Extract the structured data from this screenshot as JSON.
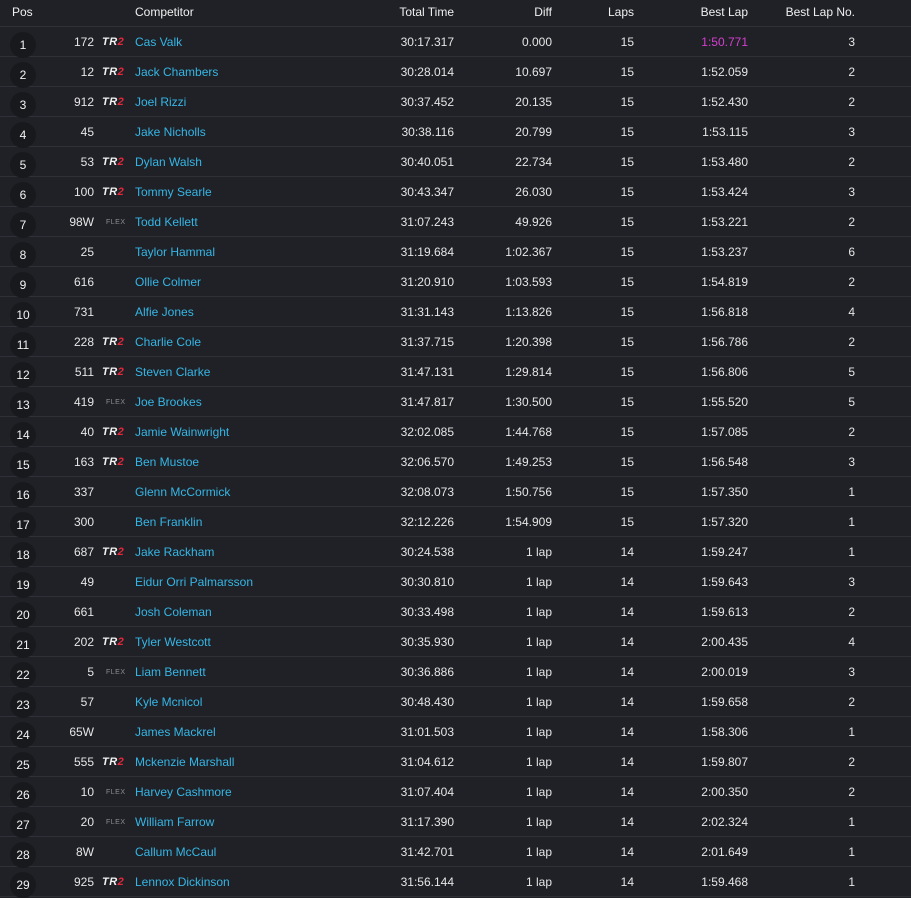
{
  "header": {
    "pos": "Pos",
    "competitor": "Competitor",
    "total_time": "Total Time",
    "diff": "Diff",
    "laps": "Laps",
    "best_lap": "Best Lap",
    "best_lap_no": "Best Lap No."
  },
  "colors": {
    "competitor_link": "#35b6e6",
    "fastest_lap": "#d63fd0",
    "tr2_red": "#e3283b",
    "background": "#1f2126"
  },
  "rows": [
    {
      "pos": "1",
      "number": "172",
      "class": "TR2",
      "competitor": "Cas Valk",
      "total_time": "30:17.317",
      "diff": "0.000",
      "laps": "15",
      "best_lap": "1:50.771",
      "best_lap_no": "3",
      "fastest": true
    },
    {
      "pos": "2",
      "number": "12",
      "class": "TR2",
      "competitor": "Jack Chambers",
      "total_time": "30:28.014",
      "diff": "10.697",
      "laps": "15",
      "best_lap": "1:52.059",
      "best_lap_no": "2"
    },
    {
      "pos": "3",
      "number": "912",
      "class": "TR2",
      "competitor": "Joel Rizzi",
      "total_time": "30:37.452",
      "diff": "20.135",
      "laps": "15",
      "best_lap": "1:52.430",
      "best_lap_no": "2"
    },
    {
      "pos": "4",
      "number": "45",
      "class": "",
      "competitor": "Jake Nicholls",
      "total_time": "30:38.116",
      "diff": "20.799",
      "laps": "15",
      "best_lap": "1:53.115",
      "best_lap_no": "3"
    },
    {
      "pos": "5",
      "number": "53",
      "class": "TR2",
      "competitor": "Dylan Walsh",
      "total_time": "30:40.051",
      "diff": "22.734",
      "laps": "15",
      "best_lap": "1:53.480",
      "best_lap_no": "2"
    },
    {
      "pos": "6",
      "number": "100",
      "class": "TR2",
      "competitor": "Tommy Searle",
      "total_time": "30:43.347",
      "diff": "26.030",
      "laps": "15",
      "best_lap": "1:53.424",
      "best_lap_no": "3"
    },
    {
      "pos": "7",
      "number": "98W",
      "class": "FLEX",
      "competitor": "Todd Kellett",
      "total_time": "31:07.243",
      "diff": "49.926",
      "laps": "15",
      "best_lap": "1:53.221",
      "best_lap_no": "2"
    },
    {
      "pos": "8",
      "number": "25",
      "class": "",
      "competitor": "Taylor Hammal",
      "total_time": "31:19.684",
      "diff": "1:02.367",
      "laps": "15",
      "best_lap": "1:53.237",
      "best_lap_no": "6"
    },
    {
      "pos": "9",
      "number": "616",
      "class": "",
      "competitor": "Ollie Colmer",
      "total_time": "31:20.910",
      "diff": "1:03.593",
      "laps": "15",
      "best_lap": "1:54.819",
      "best_lap_no": "2"
    },
    {
      "pos": "10",
      "number": "731",
      "class": "",
      "competitor": "Alfie Jones",
      "total_time": "31:31.143",
      "diff": "1:13.826",
      "laps": "15",
      "best_lap": "1:56.818",
      "best_lap_no": "4"
    },
    {
      "pos": "11",
      "number": "228",
      "class": "TR2",
      "competitor": "Charlie Cole",
      "total_time": "31:37.715",
      "diff": "1:20.398",
      "laps": "15",
      "best_lap": "1:56.786",
      "best_lap_no": "2"
    },
    {
      "pos": "12",
      "number": "511",
      "class": "TR2",
      "competitor": "Steven Clarke",
      "total_time": "31:47.131",
      "diff": "1:29.814",
      "laps": "15",
      "best_lap": "1:56.806",
      "best_lap_no": "5"
    },
    {
      "pos": "13",
      "number": "419",
      "class": "FLEX",
      "competitor": "Joe Brookes",
      "total_time": "31:47.817",
      "diff": "1:30.500",
      "laps": "15",
      "best_lap": "1:55.520",
      "best_lap_no": "5"
    },
    {
      "pos": "14",
      "number": "40",
      "class": "TR2",
      "competitor": "Jamie Wainwright",
      "total_time": "32:02.085",
      "diff": "1:44.768",
      "laps": "15",
      "best_lap": "1:57.085",
      "best_lap_no": "2"
    },
    {
      "pos": "15",
      "number": "163",
      "class": "TR2",
      "competitor": "Ben Mustoe",
      "total_time": "32:06.570",
      "diff": "1:49.253",
      "laps": "15",
      "best_lap": "1:56.548",
      "best_lap_no": "3"
    },
    {
      "pos": "16",
      "number": "337",
      "class": "",
      "competitor": "Glenn McCormick",
      "total_time": "32:08.073",
      "diff": "1:50.756",
      "laps": "15",
      "best_lap": "1:57.350",
      "best_lap_no": "1"
    },
    {
      "pos": "17",
      "number": "300",
      "class": "",
      "competitor": "Ben Franklin",
      "total_time": "32:12.226",
      "diff": "1:54.909",
      "laps": "15",
      "best_lap": "1:57.320",
      "best_lap_no": "1"
    },
    {
      "pos": "18",
      "number": "687",
      "class": "TR2",
      "competitor": "Jake Rackham",
      "total_time": "30:24.538",
      "diff": "1 lap",
      "laps": "14",
      "best_lap": "1:59.247",
      "best_lap_no": "1"
    },
    {
      "pos": "19",
      "number": "49",
      "class": "",
      "competitor": "Eidur Orri Palmarsson",
      "total_time": "30:30.810",
      "diff": "1 lap",
      "laps": "14",
      "best_lap": "1:59.643",
      "best_lap_no": "3"
    },
    {
      "pos": "20",
      "number": "661",
      "class": "",
      "competitor": "Josh Coleman",
      "total_time": "30:33.498",
      "diff": "1 lap",
      "laps": "14",
      "best_lap": "1:59.613",
      "best_lap_no": "2"
    },
    {
      "pos": "21",
      "number": "202",
      "class": "TR2",
      "competitor": "Tyler Westcott",
      "total_time": "30:35.930",
      "diff": "1 lap",
      "laps": "14",
      "best_lap": "2:00.435",
      "best_lap_no": "4"
    },
    {
      "pos": "22",
      "number": "5",
      "class": "FLEX",
      "competitor": "Liam Bennett",
      "total_time": "30:36.886",
      "diff": "1 lap",
      "laps": "14",
      "best_lap": "2:00.019",
      "best_lap_no": "3"
    },
    {
      "pos": "23",
      "number": "57",
      "class": "",
      "competitor": "Kyle Mcnicol",
      "total_time": "30:48.430",
      "diff": "1 lap",
      "laps": "14",
      "best_lap": "1:59.658",
      "best_lap_no": "2"
    },
    {
      "pos": "24",
      "number": "65W",
      "class": "",
      "competitor": "James Mackrel",
      "total_time": "31:01.503",
      "diff": "1 lap",
      "laps": "14",
      "best_lap": "1:58.306",
      "best_lap_no": "1"
    },
    {
      "pos": "25",
      "number": "555",
      "class": "TR2",
      "competitor": "Mckenzie Marshall",
      "total_time": "31:04.612",
      "diff": "1 lap",
      "laps": "14",
      "best_lap": "1:59.807",
      "best_lap_no": "2"
    },
    {
      "pos": "26",
      "number": "10",
      "class": "FLEX",
      "competitor": "Harvey Cashmore",
      "total_time": "31:07.404",
      "diff": "1 lap",
      "laps": "14",
      "best_lap": "2:00.350",
      "best_lap_no": "2"
    },
    {
      "pos": "27",
      "number": "20",
      "class": "FLEX",
      "competitor": "William Farrow",
      "total_time": "31:17.390",
      "diff": "1 lap",
      "laps": "14",
      "best_lap": "2:02.324",
      "best_lap_no": "1"
    },
    {
      "pos": "28",
      "number": "8W",
      "class": "",
      "competitor": "Callum McCaul",
      "total_time": "31:42.701",
      "diff": "1 lap",
      "laps": "14",
      "best_lap": "2:01.649",
      "best_lap_no": "1"
    },
    {
      "pos": "29",
      "number": "925",
      "class": "TR2",
      "competitor": "Lennox Dickinson",
      "total_time": "31:56.144",
      "diff": "1 lap",
      "laps": "14",
      "best_lap": "1:59.468",
      "best_lap_no": "1"
    }
  ]
}
